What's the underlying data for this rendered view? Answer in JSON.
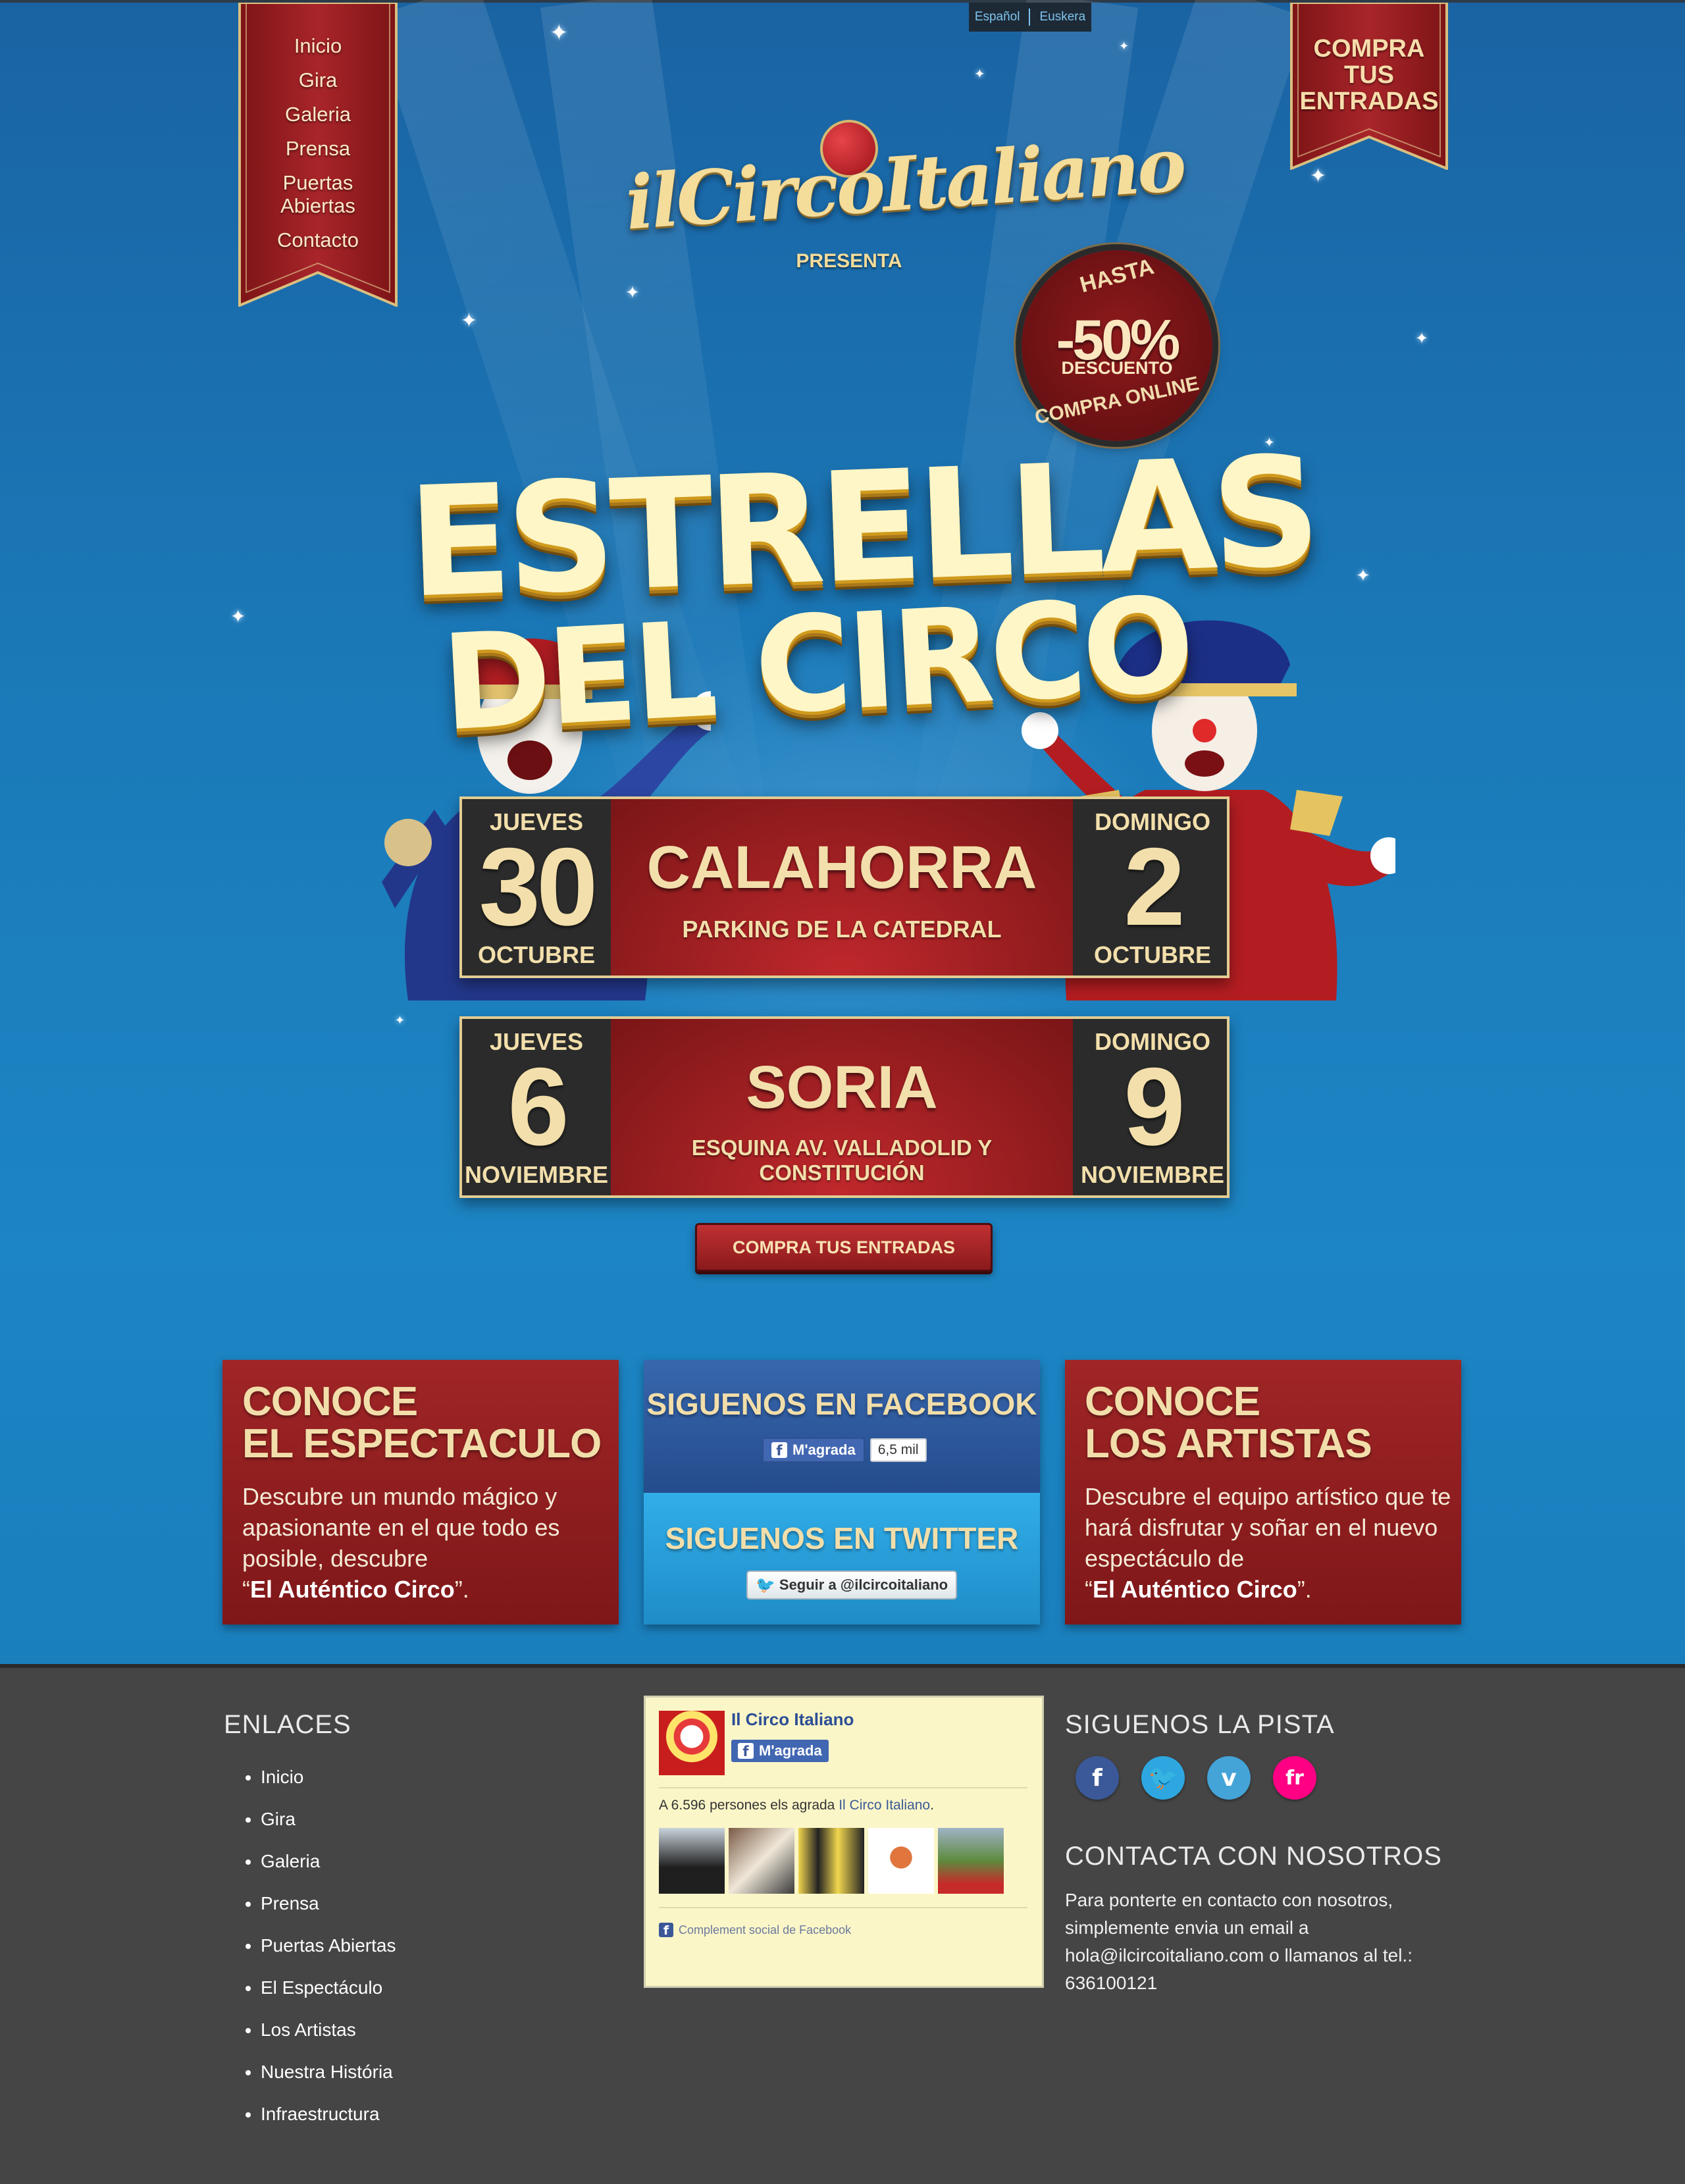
{
  "lang": {
    "es": "Español",
    "eu": "Euskera"
  },
  "nav": [
    "Inicio",
    "Gira",
    "Galeria",
    "Prensa",
    "Puertas Abiertas",
    "Contacto"
  ],
  "buy_banner": {
    "line1": "COMPRA",
    "line2": "TUS",
    "line3": "ENTRADAS"
  },
  "logo": {
    "name": "ilCircoItaliano",
    "presenta": "PRESENTA"
  },
  "seal": {
    "hasta": "HASTA",
    "pct": "-50%",
    "desc": "DESCUENTO",
    "compra": "COMPRA ONLINE"
  },
  "headline": {
    "line1": "ESTRELLAS",
    "line2": "DEL CIRCO"
  },
  "dates": [
    {
      "start_day": "JUEVES",
      "start_num": "30",
      "start_month": "OCTUBRE",
      "city": "CALAHORRA",
      "place": "PARKING DE LA CATEDRAL",
      "end_day": "DOMINGO",
      "end_num": "2",
      "end_month": "OCTUBRE"
    },
    {
      "start_day": "JUEVES",
      "start_num": "6",
      "start_month": "NOVIEMBRE",
      "city": "SORIA",
      "place": "ESQUINA AV. VALLADOLID Y CONSTITUCIÓN",
      "end_day": "DOMINGO",
      "end_num": "9",
      "end_month": "NOVIEMBRE"
    }
  ],
  "buy_button": "COMPRA TUS ENTRADAS",
  "cards": {
    "left": {
      "title1": "CONOCE",
      "title2": "EL ESPECTACULO",
      "text": "Descubre un mundo mágico y apasionante en el que todo es posible, descubre",
      "open_quote": "“",
      "bold": "El Auténtico Circo",
      "close_quote": "”."
    },
    "facebook": {
      "title": "SIGUENOS EN FACEBOOK",
      "like": "M'agrada",
      "count": "6,5 mil"
    },
    "twitter": {
      "title": "SIGUENOS EN TWITTER",
      "follow": "Seguir a @ilcircoitaliano"
    },
    "right": {
      "title1": "CONOCE",
      "title2": "LOS ARTISTAS",
      "text": "Descubre el equipo artístico que te hará disfrutar y soñar en el nuevo espectáculo de",
      "open_quote": "“",
      "bold": "El Auténtico Circo",
      "close_quote": "”."
    }
  },
  "footer": {
    "links_title": "ENLACES",
    "links": [
      "Inicio",
      "Gira",
      "Galeria",
      "Prensa",
      "Puertas Abiertas",
      "El Espectáculo",
      "Los Artistas",
      "Nuestra História",
      "Infraestructura"
    ],
    "fb_box": {
      "name": "Il Circo Italiano",
      "like": "M'agrada",
      "people_pre": "A 6.596 persones els agrada",
      "people_link": "Il Circo Italiano",
      "people_post": ".",
      "plugin": "Complement social de Facebook"
    },
    "social_title": "SIGUENOS LA PISTA",
    "social": [
      {
        "name": "facebook",
        "glyph": "f",
        "color": "#3b5998"
      },
      {
        "name": "twitter",
        "glyph": "t",
        "color": "#2ea7e0"
      },
      {
        "name": "vimeo",
        "glyph": "v",
        "color": "#44a3d7"
      },
      {
        "name": "flickr",
        "glyph": "fr",
        "color": "#ff0084"
      }
    ],
    "contact_title": "CONTACTA CON NOSOTROS",
    "contact_text": "Para ponterte en contacto con nosotros, simplemente envia un email a hola@ilcircoitaliano.com o llamanos al tel.: 636100121"
  }
}
